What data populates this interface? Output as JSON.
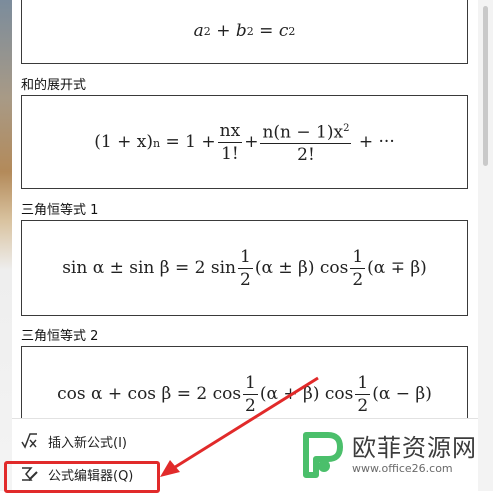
{
  "formulas": [
    {
      "label": "",
      "parts": {
        "a": "a",
        "b": "b",
        "c": "c",
        "exp": "2",
        "plus": "+",
        "eq": "="
      }
    },
    {
      "label": "和的展开式"
    },
    {
      "label": "三角恒等式 1"
    },
    {
      "label": "三角恒等式 2"
    }
  ],
  "binomial": {
    "lhs": "(1 + x)",
    "exp": "n",
    "eq": "=",
    "one": "1",
    "plus": "+",
    "f1_num": "nx",
    "f1_den": "1!",
    "f2_num": "n(n − 1)x",
    "f2_exp": "2",
    "f2_den": "2!",
    "dots": "+ ···"
  },
  "trig1": {
    "lhs": "sin α ± sin β",
    "eq": "=",
    "two_sin": "2 sin",
    "half_num": "1",
    "half_den": "2",
    "paren1": "(α ± β)",
    "cos": "cos",
    "paren2": "(α ∓ β)"
  },
  "trig2": {
    "lhs": "cos α + cos β",
    "eq": "=",
    "two_cos": "2 cos",
    "half_num": "1",
    "half_den": "2",
    "paren1": "(α + β)",
    "cos": "cos",
    "paren2": "(α − β)"
  },
  "menu": {
    "insert_label": "插入新公式(I)",
    "editor_label": "公式编辑器(Q)"
  },
  "watermark": {
    "title": "欧菲资源网",
    "url": "www.office26.com"
  },
  "colors": {
    "highlight": "#e12a2a",
    "brand_green": "#4bbf6b"
  }
}
